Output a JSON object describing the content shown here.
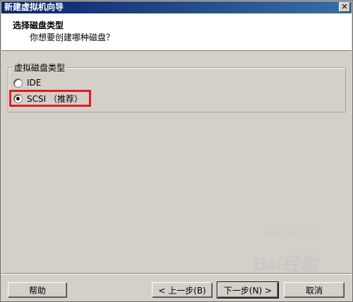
{
  "window": {
    "title": "新建虚拟机向导",
    "close_icon": "close-icon"
  },
  "header": {
    "title": "选择磁盘类型",
    "subtitle": "你想要创建哪种磁盘？"
  },
  "disk_type_group": {
    "legend": "虚拟磁盘类型",
    "options": [
      {
        "label": "IDE",
        "checked": false
      },
      {
        "label": "SCSI （推荐）",
        "checked": true
      }
    ]
  },
  "buttons": {
    "help": "帮助",
    "back": "< 上一步(B)",
    "next": "下一步(N) >",
    "cancel": "取消"
  },
  "watermark": {
    "brand": "Bai经验",
    "url": "jingyan.baidu.com"
  },
  "colors": {
    "title_bar": "#0a246a",
    "highlight_box": "#e01b22",
    "dialog_bg": "#d4d0c8"
  }
}
